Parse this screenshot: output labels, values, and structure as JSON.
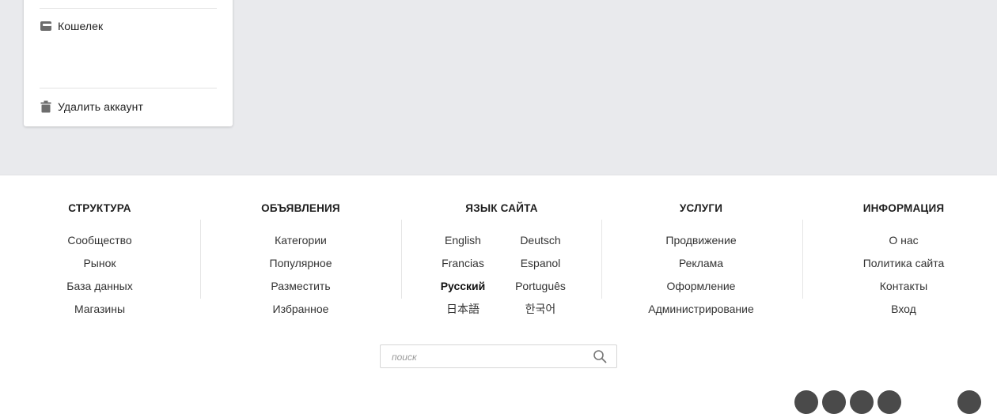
{
  "sidebar": {
    "items": [
      {
        "label": "Кошелек",
        "icon": "wallet-icon"
      },
      {
        "label": "Удалить аккаунт",
        "icon": "trash-icon"
      }
    ]
  },
  "footer": {
    "structure": {
      "title": "СТРУКТУРА",
      "links": [
        "Сообщество",
        "Рынок",
        "База данных",
        "Магазины"
      ]
    },
    "listings": {
      "title": "ОБЪЯВЛЕНИЯ",
      "links": [
        "Категории",
        "Популярное",
        "Разместить",
        "Избранное"
      ]
    },
    "language": {
      "title": "ЯЗЫК САЙТА",
      "options": [
        "English",
        "Deutsch",
        "Francias",
        "Espanol",
        "Русский",
        "Português",
        "日本語",
        "한국어"
      ],
      "selected": "Русский"
    },
    "services": {
      "title": "УСЛУГИ",
      "links": [
        "Продвижение",
        "Реклама",
        "Оформление",
        "Администрирование"
      ]
    },
    "info": {
      "title": "ИНФОРМАЦИЯ",
      "links": [
        "О нас",
        "Политика сайта",
        "Контакты",
        "Вход"
      ]
    },
    "search": {
      "placeholder": "поиск",
      "value": ""
    }
  },
  "colors": {
    "page_background": "#e9eaed",
    "footer_background": "#ffffff",
    "text": "#333333",
    "social_icon": "#4a4a4a"
  }
}
